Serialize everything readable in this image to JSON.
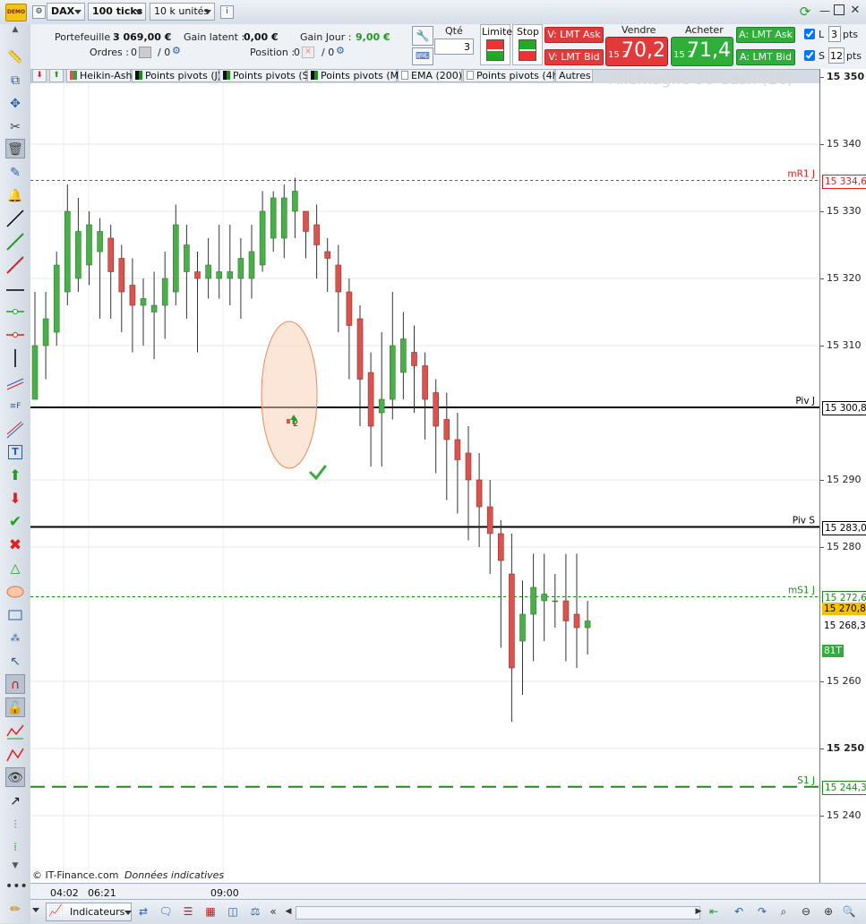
{
  "toolbar": {
    "instrument": "DAX",
    "ticks": "100 ticks",
    "units": "10 k unités",
    "demo_badge": "DEMO"
  },
  "account": {
    "portfolio_label": "Portefeuille :",
    "portfolio_value": "3 069,00 €",
    "latent_label": "Gain latent :",
    "latent_value": "0,00 €",
    "day_label": "Gain Jour :",
    "day_value": "9,00 €",
    "orders_label": "Ordres :",
    "orders_value": "0",
    "orders_sep": "/ 0",
    "position_label": "Position :",
    "position_value": "0",
    "position_sep": "/ 0"
  },
  "order": {
    "qty_label": "Qté",
    "qty_value": "3",
    "limit_label": "Limite",
    "stop_label": "Stop",
    "sell_ask": "V: LMT Ask",
    "sell_bid": "V: LMT Bid",
    "sell_label": "Vendre",
    "sell_price_small": "15 2",
    "sell_price_big": "70,2",
    "buy_label": "Acheter",
    "buy_price_small": "15 2",
    "buy_price_big": "71,4",
    "buy_ask": "A: LMT Ask",
    "buy_bid": "A: LMT Bid",
    "l_label": "L",
    "l_value": "3",
    "s_label": "S",
    "s_value": "12",
    "pts": "pts",
    "accent_red": "#e23a3a",
    "accent_green": "#2fae3a"
  },
  "indicators": {
    "items": [
      "Heikin-Ashi",
      "Points pivots (J)",
      "Points pivots (S)",
      "Points pivots (M)",
      "EMA (200)",
      "Points pivots (4h)",
      "Autres"
    ]
  },
  "chart": {
    "watermark": "Allemagne 30 Cash (1€)",
    "credit": "© IT-Finance.com",
    "credit_note": "Données indicatives",
    "y_ticks": [
      "15 350",
      "15 340",
      "15 330",
      "15 320",
      "15 310",
      "15 290",
      "15 280",
      "15 260",
      "15 250",
      "15 240"
    ],
    "x_ticks": [
      "04:02",
      "06:21",
      "09:00"
    ],
    "levels": [
      {
        "name": "mR1 J",
        "value": "15 334,6",
        "price": 15334.6,
        "color": "#e02020",
        "style": "dotted"
      },
      {
        "name": "Piv J",
        "value": "15 300,8",
        "price": 15300.8,
        "color": "#000000",
        "style": "solid"
      },
      {
        "name": "Piv S",
        "value": "15 283,0",
        "price": 15283.0,
        "color": "#000000",
        "style": "solid"
      },
      {
        "name": "mS1 J",
        "value": "15 272,6",
        "price": 15272.6,
        "color": "#1e8a1e",
        "style": "dotted"
      },
      {
        "name": "S1 J",
        "value": "15 244,3",
        "price": 15244.3,
        "color": "#1e8a1e",
        "style": "dashed"
      }
    ],
    "current_price": "15 270,8",
    "other_price": "15 268,3",
    "tick_count": "81T",
    "trade_marker": "2"
  },
  "bottom": {
    "indicators_label": "Indicateurs"
  },
  "chart_data": {
    "type": "candlestick",
    "title": "Allemagne 30 Cash (1€)",
    "ylim": [
      15235,
      15352
    ],
    "x_ticks": [
      "04:02",
      "06:21",
      "09:00"
    ],
    "candles": [
      [
        15302,
        15310,
        15302,
        15318
      ],
      [
        15310,
        15314,
        15305,
        15318
      ],
      [
        15312,
        15322,
        15310,
        15324
      ],
      [
        15318,
        15330,
        15316,
        15334
      ],
      [
        15320,
        15327,
        15318,
        15332
      ],
      [
        15322,
        15328,
        15319,
        15330
      ],
      [
        15324,
        15327,
        15314,
        15329
      ],
      [
        15326,
        15321,
        15314,
        15328
      ],
      [
        15323,
        15318,
        15312,
        15325
      ],
      [
        15319,
        15316,
        15309,
        15323
      ],
      [
        15316,
        15317,
        15310,
        15320
      ],
      [
        15315,
        15316,
        15308,
        15321
      ],
      [
        15316,
        15320,
        15311,
        15324
      ],
      [
        15318,
        15328,
        15316,
        15331
      ],
      [
        15321,
        15325,
        15314,
        15328
      ],
      [
        15321,
        15320,
        15309,
        15324
      ],
      [
        15320,
        15322,
        15317,
        15326
      ],
      [
        15320,
        15321,
        15317,
        15328
      ],
      [
        15320,
        15321,
        15316,
        15328
      ],
      [
        15320,
        15323,
        15314,
        15326
      ],
      [
        15320,
        15324,
        15317,
        15328
      ],
      [
        15322,
        15330,
        15321,
        15333
      ],
      [
        15326,
        15332,
        15324,
        15333
      ],
      [
        15326,
        15332,
        15323,
        15334
      ],
      [
        15330,
        15333,
        15326,
        15335
      ],
      [
        15330,
        15327,
        15323,
        15330
      ],
      [
        15328,
        15325,
        15320,
        15331
      ],
      [
        15324,
        15323,
        15318,
        15326
      ],
      [
        15322,
        15318,
        15312,
        15325
      ],
      [
        15318,
        15313,
        15305,
        15320
      ],
      [
        15314,
        15305,
        15298,
        15316
      ],
      [
        15306,
        15298,
        15292,
        15309
      ],
      [
        15300,
        15302,
        15292,
        15312
      ],
      [
        15302,
        15310,
        15299,
        15318
      ],
      [
        15306,
        15311,
        15302,
        15315
      ],
      [
        15309,
        15307,
        15300,
        15313
      ],
      [
        15307,
        15302,
        15296,
        15309
      ],
      [
        15303,
        15298,
        15291,
        15305
      ],
      [
        15299,
        15296,
        15287,
        15303
      ],
      [
        15296,
        15293,
        15285,
        15300
      ],
      [
        15294,
        15290,
        15281,
        15298
      ],
      [
        15290,
        15286,
        15280,
        15294
      ],
      [
        15286,
        15282,
        15276,
        15290
      ],
      [
        15282,
        15278,
        15265,
        15284
      ],
      [
        15276,
        15262,
        15254,
        15282
      ],
      [
        15266,
        15270,
        15258,
        15275
      ],
      [
        15270,
        15274,
        15263,
        15279
      ],
      [
        15272,
        15273,
        15266,
        15279
      ],
      [
        15272,
        15272,
        15268,
        15276
      ],
      [
        15272,
        15269,
        15263,
        15279
      ],
      [
        15270,
        15268,
        15262,
        15279
      ],
      [
        15268,
        15269,
        15264,
        15272
      ]
    ]
  }
}
